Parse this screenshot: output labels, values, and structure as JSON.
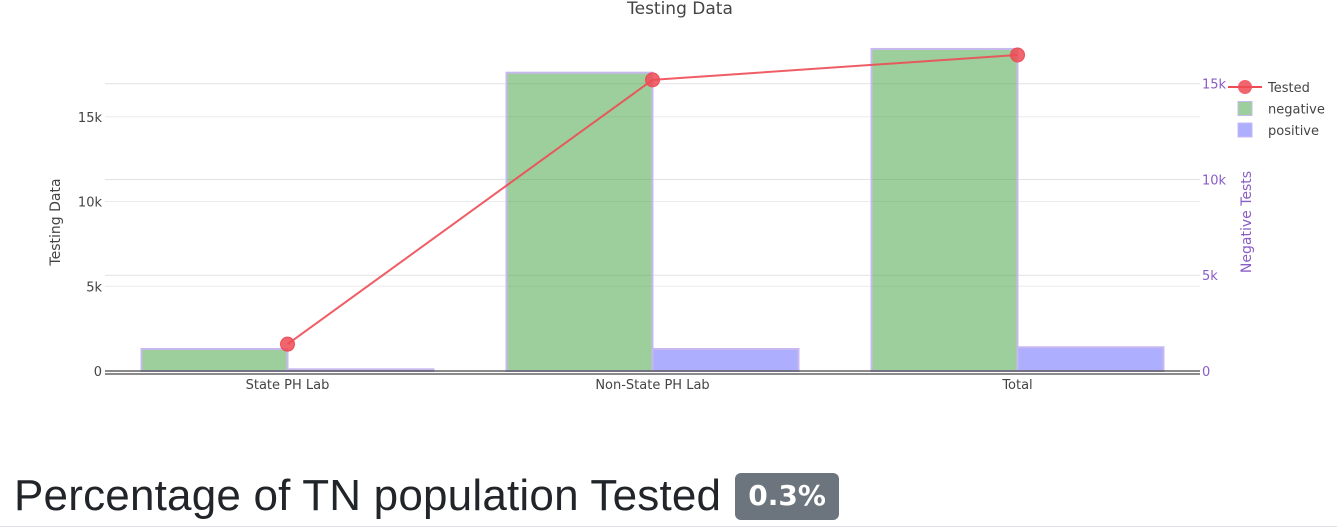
{
  "chart_data": {
    "type": "bar",
    "title": "Testing Data",
    "categories": [
      "State PH Lab",
      "Non-State PH Lab",
      "Total"
    ],
    "series": [
      {
        "name": "negative",
        "type": "bar",
        "axis": "left",
        "color": "#4aa84a",
        "values": [
          1300,
          17600,
          19000
        ]
      },
      {
        "name": "positive",
        "type": "bar",
        "axis": "left",
        "color": "#6b6bff",
        "values": [
          100,
          1300,
          1400
        ]
      },
      {
        "name": "Tested",
        "type": "line",
        "axis": "right",
        "color": "#ee4b55",
        "values": [
          1400,
          15200,
          16500
        ]
      }
    ],
    "ylabel": "Testing Data",
    "y2label": "Negative Tests",
    "ylim": [
      0,
      20000
    ],
    "y2lim": [
      0,
      17700
    ],
    "yticks": [
      0,
      5000,
      10000,
      15000
    ],
    "ytick_labels": [
      "0",
      "5k",
      "10k",
      "15k"
    ],
    "y2ticks": [
      0,
      5000,
      10000,
      15000
    ],
    "y2tick_labels": [
      "0",
      "5k",
      "10k",
      "15k"
    ],
    "grid": true,
    "legend": "top-right",
    "legend_entries": [
      "Tested",
      "negative",
      "positive"
    ]
  },
  "stat": {
    "title": "Percentage of TN population Tested",
    "badge": "0.3%"
  }
}
